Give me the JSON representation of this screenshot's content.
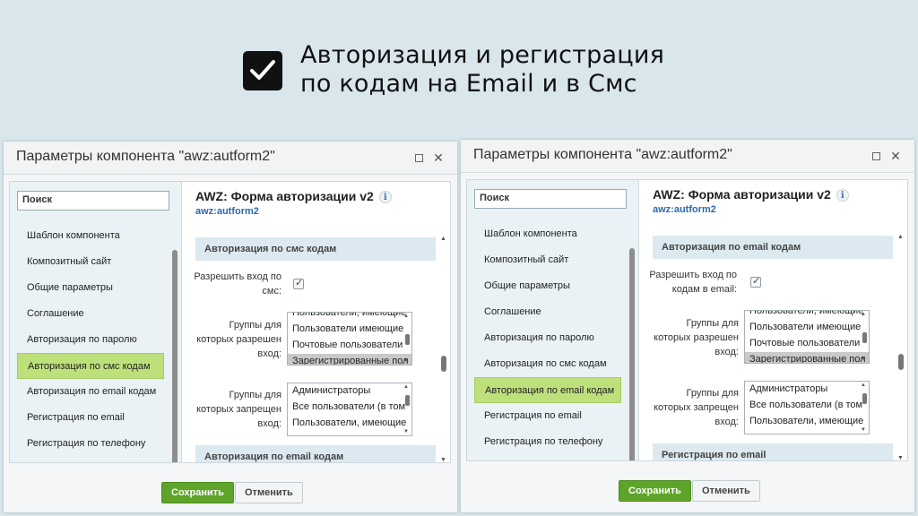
{
  "hero": {
    "line1": "Авторизация и регистрация",
    "line2": "по кодам на Email и в Смс",
    "icon": "checkbox-checked-icon"
  },
  "dialogs": [
    {
      "title": "Параметры компонента \"awz:autform2\"",
      "search_placeholder": "Поиск",
      "sidebar": [
        "Шаблон компонента",
        "Композитный сайт",
        "Общие параметры",
        "Соглашение",
        "Авторизация по паролю",
        "Авторизация по смс кодам",
        "Авторизация по email кодам",
        "Регистрация по email",
        "Регистрация по телефону"
      ],
      "active_index": 5,
      "component_title": "AWZ: Форма авторизации v2",
      "component_code": "awz:autform2",
      "section1": "Авторизация по смс кодам",
      "allow_label": "Разрешить вход по смс:",
      "allow_groups_label": "Группы для которых разрешен вход:",
      "allow_groups": [
        "Пользователи, имеющие",
        "Пользователи имеющие",
        "Почтовые пользователи",
        "Зарегистрированные пол"
      ],
      "deny_groups_label": "Группы для которых запрещен вход:",
      "deny_groups": [
        "Администраторы",
        "Все пользователи (в том",
        "Пользователи, имеющие"
      ],
      "section2": "Авторизация по email кодам",
      "save": "Сохранить",
      "cancel": "Отменить"
    },
    {
      "title": "Параметры компонента \"awz:autform2\"",
      "search_placeholder": "Поиск",
      "sidebar": [
        "Шаблон компонента",
        "Композитный сайт",
        "Общие параметры",
        "Соглашение",
        "Авторизация по паролю",
        "Авторизация по смс кодам",
        "Авторизация по email кодам",
        "Регистрация по email",
        "Регистрация по телефону"
      ],
      "active_index": 6,
      "component_title": "AWZ: Форма авторизации v2",
      "component_code": "awz:autform2",
      "section1": "Авторизация по email кодам",
      "allow_label": "Разрешить вход по кодам в email:",
      "allow_groups_label": "Группы для которых разрешен вход:",
      "allow_groups": [
        "Пользователи, имеющие",
        "Пользователи имеющие",
        "Почтовые пользователи",
        "Зарегистрированные пол"
      ],
      "deny_groups_label": "Группы для которых запрещен вход:",
      "deny_groups": [
        "Администраторы",
        "Все пользователи (в том",
        "Пользователи, имеющие"
      ],
      "section2": "Регистрация по email",
      "save": "Сохранить",
      "cancel": "Отменить"
    }
  ]
}
